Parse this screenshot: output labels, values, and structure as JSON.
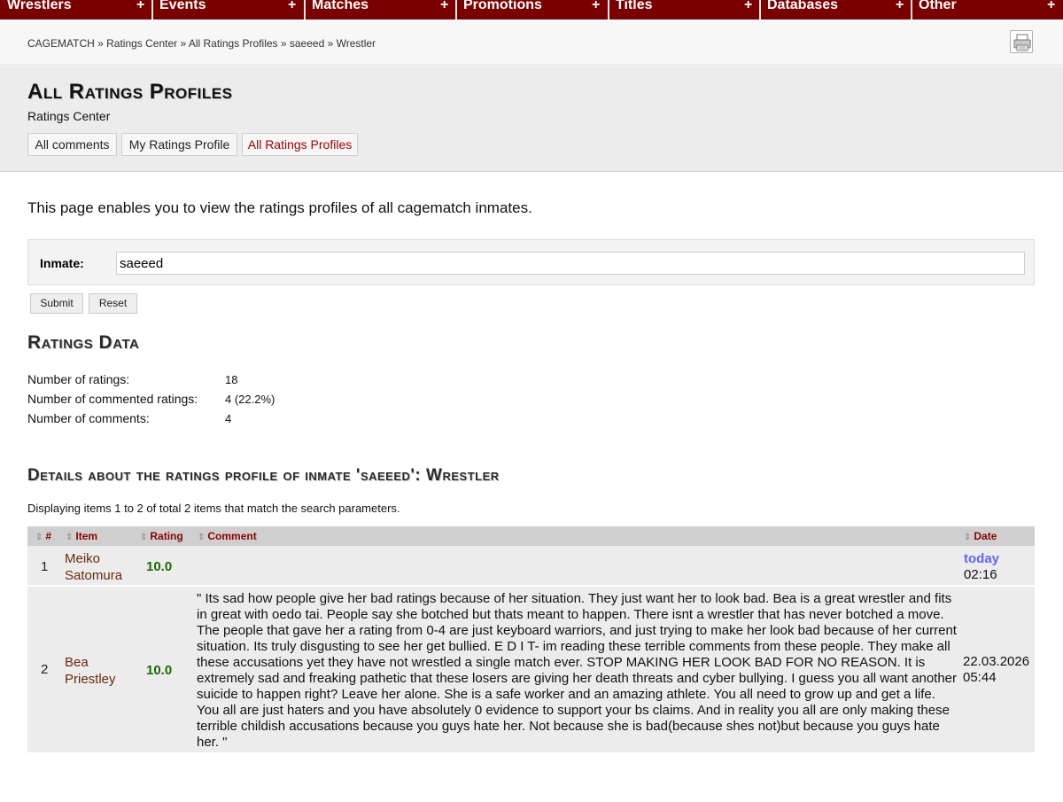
{
  "nav": {
    "items": [
      {
        "label": "Wrestlers"
      },
      {
        "label": "Events"
      },
      {
        "label": "Matches"
      },
      {
        "label": "Promotions"
      },
      {
        "label": "Titles"
      },
      {
        "label": "Databases"
      },
      {
        "label": "Other"
      }
    ],
    "plus": "+"
  },
  "breadcrumb": "CAGEMATCH » Ratings Center » All Ratings Profiles » saeeed » Wrestler",
  "header": {
    "title": "All Ratings Profiles",
    "subtitle": "Ratings Center",
    "tabs": [
      {
        "label": "All comments"
      },
      {
        "label": "My Ratings Profile"
      },
      {
        "label": "All Ratings Profiles"
      }
    ]
  },
  "intro": "This page enables you to view the ratings profiles of all cagematch inmates.",
  "search": {
    "label": "Inmate:",
    "value": "saeeed",
    "submit": "Submit",
    "reset": "Reset"
  },
  "ratings_data": {
    "title": "Ratings Data",
    "stats": [
      {
        "label": "Number of ratings:",
        "value": "18"
      },
      {
        "label": "Number of commented ratings:",
        "value": "4 (22.2%)"
      },
      {
        "label": "Number of comments:",
        "value": "4"
      }
    ]
  },
  "details": {
    "title": "Details about the ratings profile of inmate 'saeeed': Wrestler",
    "displaying": "Displaying items 1 to 2 of total 2 items that match the search parameters.",
    "columns": {
      "num": "#",
      "item": "Item",
      "rating": "Rating",
      "comment": "Comment",
      "date": "Date"
    },
    "sort_glyph": "⇕",
    "rows": [
      {
        "num": "1",
        "item_line1": "Meiko",
        "item_line2": "Satomura",
        "rating": "10.0",
        "comment": "",
        "date_line1": "today",
        "date_line2": "02:16"
      },
      {
        "num": "2",
        "item_line1": "Bea",
        "item_line2": "Priestley",
        "rating": "10.0",
        "comment": "\" Its sad how people give her bad ratings because of her situation. They just want her to look bad. Bea is a great wrestler and fits in great with oedo tai. People say she botched but thats meant to happen. There isnt a wrestler that has never botched a move. The people that gave her a rating from 0-4 are just keyboard warriors, and just trying to make her look bad because of her current situation. Its truly disgusting to see her get bullied. E D I T- im reading these terrible comments from these people. They make all these accusations yet they have not wrestled a single match ever. STOP MAKING HER LOOK BAD FOR NO REASON. It is extremely sad and freaking pathetic that these losers are giving her death threats and cyber bullying. I guess you all want another suicide to happen right? Leave her alone. She is a safe worker and an amazing athlete. You all need to grow up and get a life. You all are just haters and you have absolutely 0 evidence to support your bs claims. And in reality you all are only making these terrible childish accusations because you guys hate her. Not because she is bad(because shes not)but because you guys hate her. \"",
        "date_line1": "22.03.2026",
        "date_line2": "05:44"
      }
    ]
  }
}
